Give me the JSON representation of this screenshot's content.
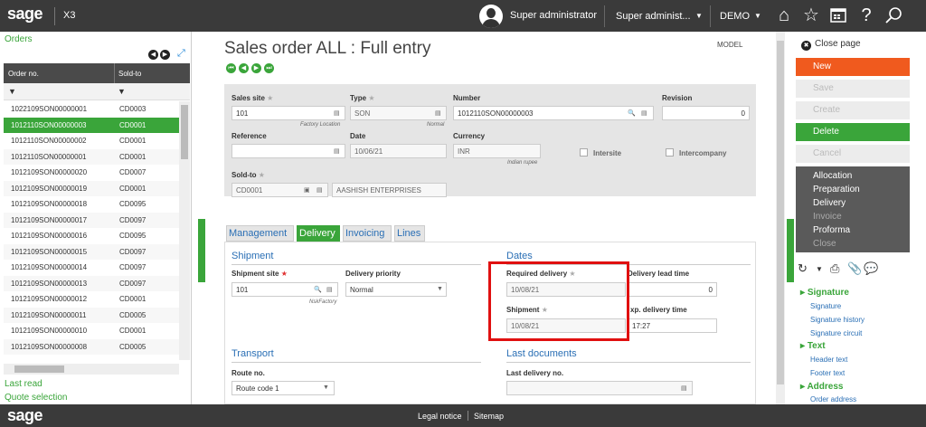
{
  "topbar": {
    "logo": "sage",
    "app": "X3",
    "user": "Super administrator",
    "user_short": "Super administ...",
    "folder": "DEMO",
    "icons": [
      "home-icon",
      "star-icon",
      "calendar-icon",
      "help-icon",
      "search-icon"
    ]
  },
  "left": {
    "title": "Orders",
    "col_order": "Order no.",
    "col_sold": "Sold-to",
    "rows": [
      {
        "order": "1022109SON00000001",
        "sold": "CD0003"
      },
      {
        "order": "1012110SON00000003",
        "sold": "CD0001"
      },
      {
        "order": "1012110SON00000002",
        "sold": "CD0001"
      },
      {
        "order": "1012110SON00000001",
        "sold": "CD0001"
      },
      {
        "order": "1012109SON00000020",
        "sold": "CD0007"
      },
      {
        "order": "1012109SON00000019",
        "sold": "CD0001"
      },
      {
        "order": "1012109SON00000018",
        "sold": "CD0095"
      },
      {
        "order": "1012109SON00000017",
        "sold": "CD0097"
      },
      {
        "order": "1012109SON00000016",
        "sold": "CD0095"
      },
      {
        "order": "1012109SON00000015",
        "sold": "CD0097"
      },
      {
        "order": "1012109SON00000014",
        "sold": "CD0097"
      },
      {
        "order": "1012109SON00000013",
        "sold": "CD0097"
      },
      {
        "order": "1012109SON00000012",
        "sold": "CD0001"
      },
      {
        "order": "1012109SON00000011",
        "sold": "CD0005"
      },
      {
        "order": "1012109SON00000010",
        "sold": "CD0001"
      },
      {
        "order": "1012109SON00000008",
        "sold": "CD0005"
      }
    ],
    "last_read": "Last read",
    "quote_selection": "Quote selection"
  },
  "page": {
    "title": "Sales order ALL : Full entry",
    "model": "MODEL",
    "sales_site_label": "Sales site",
    "sales_site": "101",
    "sales_site_desc": "Factory Location",
    "type_label": "Type",
    "type": "SON",
    "type_desc": "Normal",
    "number_label": "Number",
    "number": "1012110SON00000003",
    "revision_label": "Revision",
    "revision": "0",
    "reference_label": "Reference",
    "reference": "",
    "date_label": "Date",
    "date": "10/06/21",
    "currency_label": "Currency",
    "currency": "INR",
    "currency_desc": "Indian rupee",
    "intersite": "Intersite",
    "intercompany": "Intercompany",
    "soldto_label": "Sold-to",
    "soldto": "CD0001",
    "soldto_name": "AASHISH ENTERPRISES"
  },
  "tabs": [
    "Management",
    "Delivery",
    "Invoicing",
    "Lines"
  ],
  "delivery": {
    "shipment_title": "Shipment",
    "shipment_site_label": "Shipment site",
    "shipment_site": "101",
    "shipment_site_desc": "NskFactory",
    "priority_label": "Delivery priority",
    "priority": "Normal",
    "dates_title": "Dates",
    "required_label": "Required delivery",
    "required": "10/08/21",
    "leadtime_label": "Delivery lead time",
    "leadtime": "0",
    "shipment_label": "Shipment",
    "shipment": "10/08/21",
    "exptime_label": "xp. delivery time",
    "exptime": "17:27",
    "transport_title": "Transport",
    "route_label": "Route no.",
    "route": "Route code 1",
    "lastdocs_title": "Last documents",
    "lastdel_label": "Last delivery no.",
    "lastdel": ""
  },
  "right": {
    "close": "Close page",
    "new": "New",
    "save": "Save",
    "create": "Create",
    "delete": "Delete",
    "cancel": "Cancel",
    "menu": [
      "Allocation",
      "Preparation",
      "Delivery",
      "Invoice",
      "Proforma",
      "Close"
    ],
    "signature_h": "Signature",
    "signature_items": [
      "Signature",
      "Signature history",
      "Signature circuit"
    ],
    "text_h": "Text",
    "text_items": [
      "Header text",
      "Footer text"
    ],
    "address_h": "Address",
    "address_items": [
      "Order address"
    ]
  },
  "footer": {
    "logo": "sage",
    "legal": "Legal notice",
    "sitemap": "Sitemap"
  }
}
